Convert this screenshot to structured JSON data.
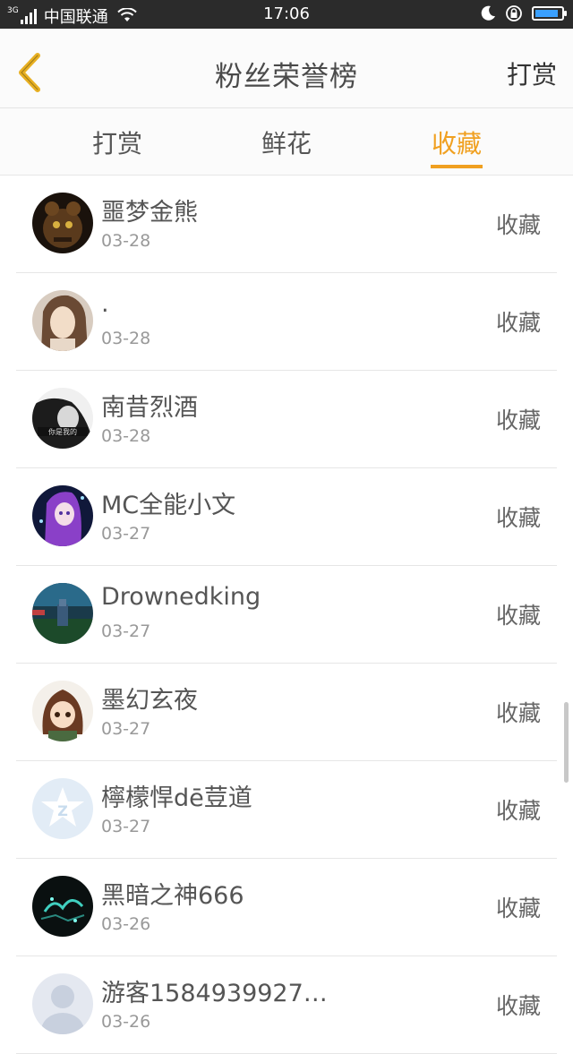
{
  "status_bar": {
    "network": "3G",
    "carrier": "中国联通",
    "time": "17:06",
    "icons": [
      "signal-icon",
      "wifi-icon",
      "moon-icon",
      "rotation-lock-icon",
      "battery-icon"
    ],
    "battery_level": 0.9
  },
  "header": {
    "title": "粉丝荣誉榜",
    "back_icon": "chevron-left-icon",
    "action_label": "打赏",
    "accent_color": "#f0a020"
  },
  "tabs": [
    {
      "label": "打赏",
      "active": false
    },
    {
      "label": "鲜花",
      "active": false
    },
    {
      "label": "收藏",
      "active": true
    }
  ],
  "fans": [
    {
      "name": "噩梦金熊",
      "date": "03-28",
      "action": "收藏"
    },
    {
      "name": ".",
      "date": "03-28",
      "action": "收藏"
    },
    {
      "name": "南昔烈酒",
      "date": "03-28",
      "action": "收藏"
    },
    {
      "name": "MC全能小文",
      "date": "03-27",
      "action": "收藏"
    },
    {
      "name": "Drownedking",
      "date": "03-27",
      "action": "收藏"
    },
    {
      "name": "墨幻玄夜",
      "date": "03-27",
      "action": "收藏"
    },
    {
      "name": "檸檬悍dē荳道",
      "date": "03-27",
      "action": "收藏"
    },
    {
      "name": "黑暗之神666",
      "date": "03-26",
      "action": "收藏"
    },
    {
      "name": "游客1584939927…",
      "date": "03-26",
      "action": "收藏"
    }
  ]
}
